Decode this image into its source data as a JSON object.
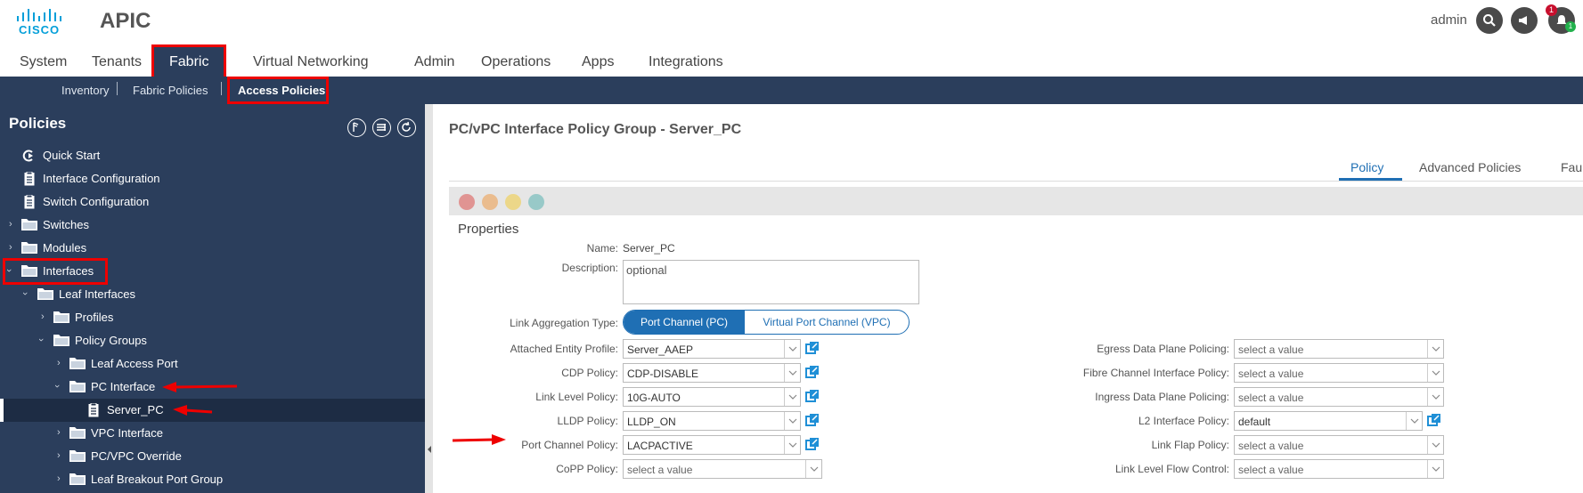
{
  "header": {
    "logo_text": "CISCO",
    "app_title": "APIC",
    "user": "admin",
    "notification_count": "1",
    "notification_count_green": "1"
  },
  "main_tabs": [
    "System",
    "Tenants",
    "Fabric",
    "Virtual Networking",
    "Admin",
    "Operations",
    "Apps",
    "Integrations"
  ],
  "sub_nav": [
    "Inventory",
    "Fabric Policies",
    "Access Policies"
  ],
  "sidebar": {
    "title": "Policies",
    "items": [
      {
        "label": "Quick Start",
        "icon": "quick-start-icon"
      },
      {
        "label": "Interface Configuration",
        "icon": "document-icon"
      },
      {
        "label": "Switch Configuration",
        "icon": "document-icon"
      },
      {
        "label": "Switches",
        "icon": "folder-icon"
      },
      {
        "label": "Modules",
        "icon": "folder-icon"
      },
      {
        "label": "Interfaces",
        "icon": "folder-icon"
      },
      {
        "label": "Leaf Interfaces",
        "icon": "folder-icon"
      },
      {
        "label": "Profiles",
        "icon": "folder-icon"
      },
      {
        "label": "Policy Groups",
        "icon": "folder-icon"
      },
      {
        "label": "Leaf Access Port",
        "icon": "folder-icon"
      },
      {
        "label": "PC Interface",
        "icon": "folder-icon"
      },
      {
        "label": "Server_PC",
        "icon": "document-icon"
      },
      {
        "label": "VPC Interface",
        "icon": "folder-icon"
      },
      {
        "label": "PC/VPC Override",
        "icon": "folder-icon"
      },
      {
        "label": "Leaf Breakout Port Group",
        "icon": "folder-icon"
      }
    ]
  },
  "content": {
    "title": "PC/vPC Interface Policy Group - Server_PC",
    "tabs": [
      "Policy",
      "Advanced Policies",
      "Fau"
    ],
    "properties_title": "Properties",
    "name_label": "Name:",
    "name_value": "Server_PC",
    "description_label": "Description:",
    "description_placeholder": "optional",
    "link_agg_label": "Link Aggregation Type:",
    "link_agg_options": [
      "Port Channel (PC)",
      "Virtual Port Channel (VPC)"
    ],
    "left_fields": [
      {
        "label": "Attached Entity Profile:",
        "value": "Server_AAEP"
      },
      {
        "label": "CDP Policy:",
        "value": "CDP-DISABLE"
      },
      {
        "label": "Link Level Policy:",
        "value": "10G-AUTO"
      },
      {
        "label": "LLDP Policy:",
        "value": "LLDP_ON"
      },
      {
        "label": "Port Channel Policy:",
        "value": "LACPACTIVE"
      },
      {
        "label": "CoPP Policy:",
        "value": "select a value"
      }
    ],
    "right_fields": [
      {
        "label": "Egress Data Plane Policing:",
        "value": "select a value"
      },
      {
        "label": "Fibre Channel Interface Policy:",
        "value": "select a value"
      },
      {
        "label": "Ingress Data Plane Policing:",
        "value": "select a value"
      },
      {
        "label": "L2 Interface Policy:",
        "value": "default"
      },
      {
        "label": "Link Flap Policy:",
        "value": "select a value"
      },
      {
        "label": "Link Level Flow Control:",
        "value": "select a value"
      }
    ]
  },
  "colors": {
    "nav_bg": "#2b3e5c",
    "accent": "#1f6fb4",
    "highlight": "#e00000"
  }
}
